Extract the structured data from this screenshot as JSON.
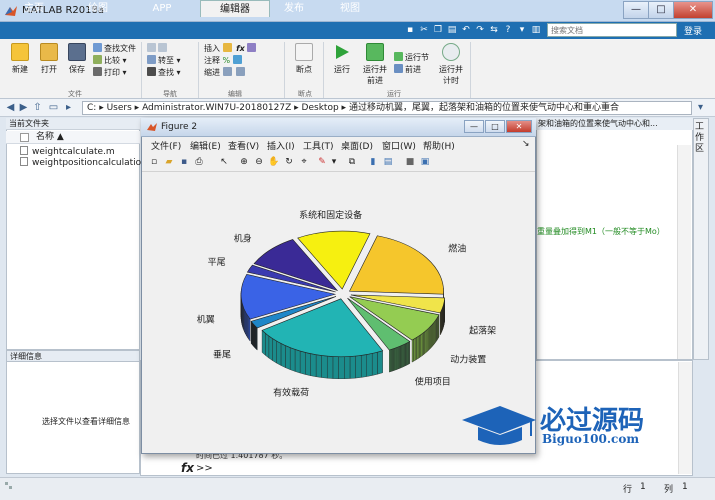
{
  "window": {
    "title": "MATLAB R2018a",
    "min": "—",
    "max": "□",
    "close": "✕"
  },
  "tabs": [
    {
      "label": "主页"
    },
    {
      "label": "绘图"
    },
    {
      "label": "APP"
    },
    {
      "label": "编辑器"
    },
    {
      "label": "发布"
    },
    {
      "label": "视图"
    }
  ],
  "search": {
    "placeholder": "搜索文档"
  },
  "login": "登录",
  "ribbon": {
    "file": {
      "new": "新建",
      "open": "打开",
      "save": "保存",
      "find_file": "查找文件",
      "compare": "比较",
      "print": "打印",
      "group": "文件"
    },
    "nav": {
      "goto": "转至",
      "find": "查找",
      "group": "导航"
    },
    "edit": {
      "insert": "插入",
      "comment": "注释",
      "indent": "缩进",
      "group": "编辑"
    },
    "breakpoints": {
      "label": "断点",
      "group": "断点"
    },
    "run": {
      "run": "运行",
      "run_advance": "运行并前进",
      "run_section": "运行节",
      "advance": "前进",
      "run_time": "运行并计时",
      "group": "运行"
    }
  },
  "address": {
    "parts": [
      "C:",
      "Users",
      "Administrator.WIN7U-20180127Z",
      "Desktop",
      "通过移动机翼，尾翼，起落架和油箱的位置来使气动中心和重心重合"
    ]
  },
  "current_folder": {
    "title": "当前文件夹",
    "column": "名称 ▲",
    "files": [
      "weightcalculate.m",
      "weightpositioncalculation.m"
    ]
  },
  "details": {
    "title": "详细信息",
    "message": "选择文件以查看详细信息"
  },
  "editor": {
    "tab": "架和油箱的位置来使气动中心和...",
    "line": "重量叠加得到M1（一般不等于Mo）"
  },
  "workspace": {
    "label": "工作区"
  },
  "command": {
    "elapsed": "时间已过 1.401787 秒。",
    "prompt": ">>"
  },
  "status": {
    "row_label": "行",
    "row": "1",
    "col_label": "列",
    "col": "1"
  },
  "figure": {
    "title": "Figure 2",
    "menus": [
      "文件(F)",
      "编辑(E)",
      "查看(V)",
      "插入(I)",
      "工具(T)",
      "桌面(D)",
      "窗口(W)",
      "帮助(H)"
    ]
  },
  "chart_data": {
    "type": "pie",
    "title": "",
    "categories": [
      "燃油",
      "起落架",
      "动力装置",
      "使用项目",
      "有效载荷",
      "垂尾",
      "机翼",
      "平尾",
      "机身",
      "系统和固定设备"
    ],
    "values": [
      20,
      4,
      8,
      4,
      22,
      2,
      12,
      2,
      9,
      12
    ],
    "colors": [
      "#f5c62c",
      "#f0e44a",
      "#94cc52",
      "#5fbe70",
      "#22b4b4",
      "#1f86c8",
      "#3a63e6",
      "#3a3ab0",
      "#3a2a96",
      "#f6f010"
    ],
    "exploded": true
  },
  "watermark": {
    "text": "必过源码",
    "url": "Biguo100.com"
  }
}
